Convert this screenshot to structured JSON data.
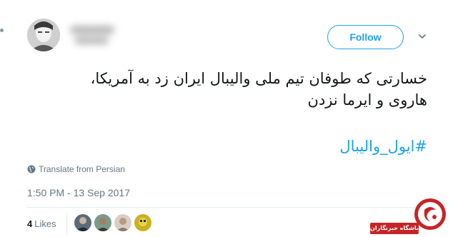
{
  "tweet": {
    "follow_label": "Follow",
    "text_lines": [
      "خسارتی که طوفان تیم ملی والیبال ایران زد به آمریکا،",
      "هاروی و ایرما نزدن"
    ],
    "hashtag": "#ایول_والیبال",
    "translate_label": "Translate from Persian",
    "timestamp": "1:50 PM - 13 Sep 2017",
    "likes_count": "4",
    "likes_label": "Likes"
  },
  "watermark": {
    "text": "باشگاه خبرنگاران"
  },
  "colors": {
    "accent": "#1da1f2",
    "muted_text": "#657786",
    "body_text": "#14171a",
    "divider": "#e6ecf0",
    "watermark_red": "#c42527"
  },
  "icons": {
    "caret": "chevron-down-icon",
    "translate": "globe-icon",
    "watermark_logo": "news-agency-logo"
  }
}
